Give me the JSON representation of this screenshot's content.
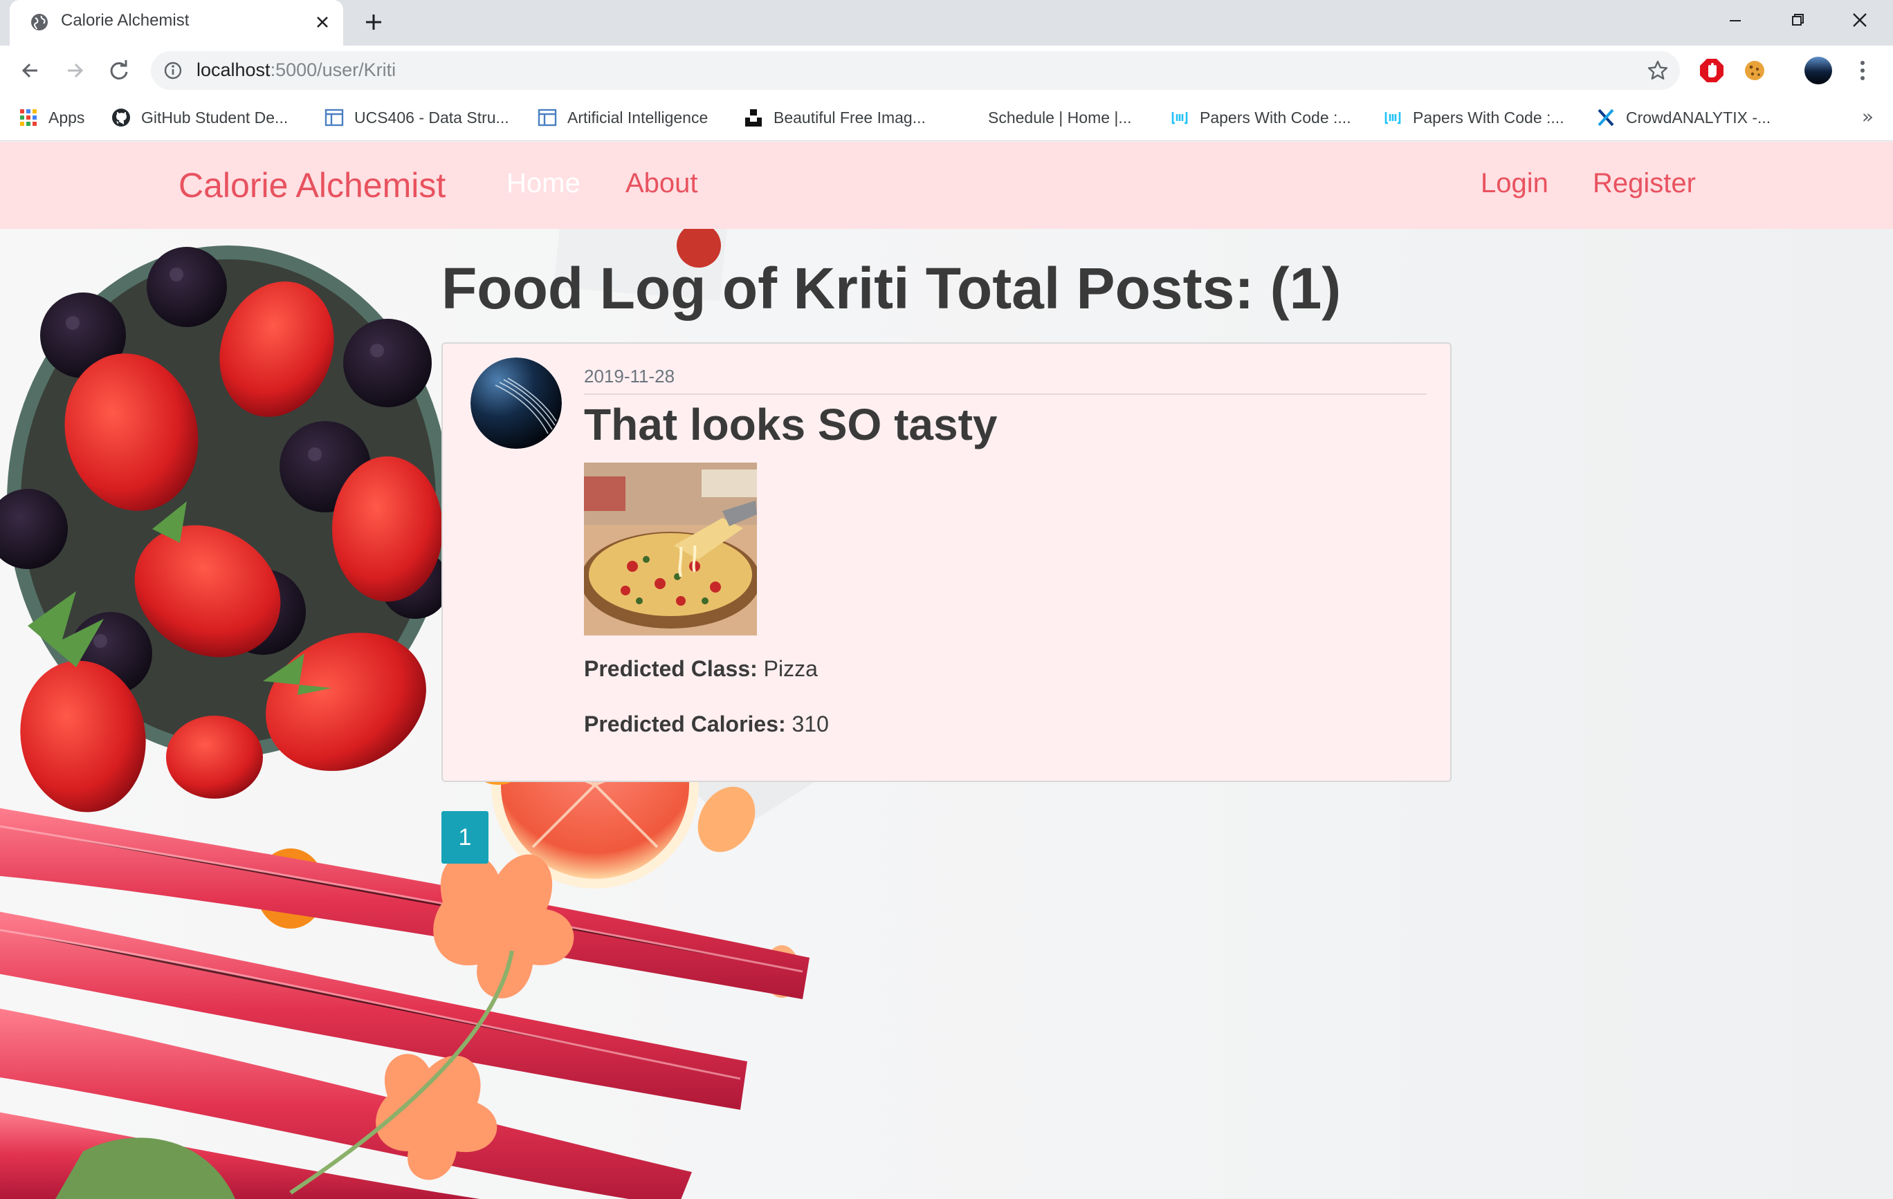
{
  "browser": {
    "tab_title": "Calorie Alchemist",
    "url_host": "localhost",
    "url_rest": ":5000/user/Kriti",
    "bookmarks": [
      {
        "label": "Apps",
        "icon": "apps-grid-icon"
      },
      {
        "label": "GitHub Student De...",
        "icon": "github-icon"
      },
      {
        "label": "UCS406 - Data Stru...",
        "icon": "page-icon"
      },
      {
        "label": "Artificial Intelligence",
        "icon": "page-icon"
      },
      {
        "label": "Beautiful Free Imag...",
        "icon": "unsplash-icon"
      },
      {
        "label": "Schedule | Home |...",
        "icon": ""
      },
      {
        "label": "Papers With Code :...",
        "icon": "papers-with-code-icon"
      },
      {
        "label": "Papers With Code :...",
        "icon": "papers-with-code-icon"
      },
      {
        "label": "CrowdANALYTIX -...",
        "icon": "crowdanalytix-icon"
      }
    ],
    "more_bookmarks": "»"
  },
  "navbar": {
    "brand": "Calorie Alchemist",
    "links": [
      {
        "label": "Home",
        "active": true
      },
      {
        "label": "About",
        "active": false
      }
    ],
    "right_links": [
      {
        "label": "Login"
      },
      {
        "label": "Register"
      }
    ]
  },
  "main": {
    "heading": "Food Log of Kriti Total Posts: (1)",
    "posts": [
      {
        "date": "2019-11-28",
        "title": "That looks SO tasty",
        "class_label": "Predicted Class:",
        "class_value": " Pizza",
        "calories_label": "Predicted Calories:",
        "calories_value": " 310"
      }
    ],
    "pagination": [
      "1"
    ]
  },
  "colors": {
    "navbar_bg": "#ffe0e3",
    "brand": "#e8525f",
    "card_bg": "#ffeff1",
    "pagination_bg": "#17a2b8"
  }
}
